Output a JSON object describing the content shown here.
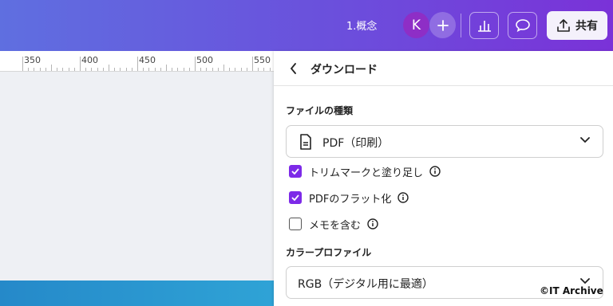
{
  "header": {
    "doc_title": "1.概念",
    "avatar_initial": "K",
    "add_symbol": "+",
    "share_label": "共有"
  },
  "ruler": {
    "labels": [
      "350",
      "400",
      "450",
      "500",
      "550"
    ]
  },
  "panel": {
    "title": "ダウンロード",
    "file_type_label": "ファイルの種類",
    "file_type_value": "PDF（印刷）",
    "options": [
      {
        "label": "トリムマークと塗り足し",
        "checked": true
      },
      {
        "label": "PDFのフラット化",
        "checked": true
      },
      {
        "label": "メモを含む",
        "checked": false
      }
    ],
    "color_profile_label": "カラープロファイル",
    "color_profile_value": "RGB（デジタル用に最適）"
  },
  "watermark": "©IT Archive",
  "colors": {
    "accent": "#7d2ae8",
    "topbar_start": "#5f6fe0",
    "topbar_end": "#7a32d8",
    "avatar": "#8e2ec6"
  },
  "icons": [
    "chevron-left-icon",
    "plus-icon",
    "chart-icon",
    "comment-icon",
    "share-upload-icon",
    "document-icon",
    "chevron-down-icon",
    "info-icon",
    "checkmark-icon"
  ]
}
